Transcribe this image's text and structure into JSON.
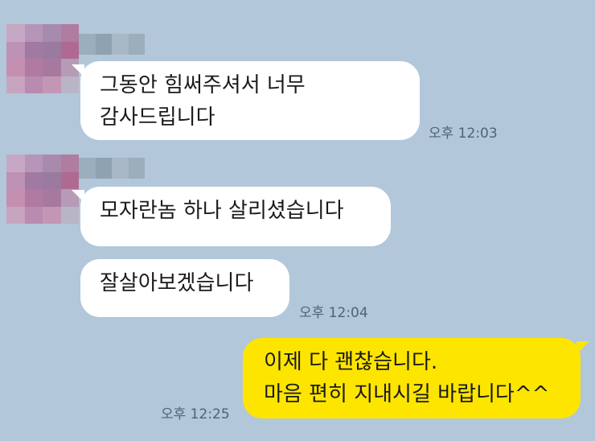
{
  "messages": [
    {
      "sender": "other",
      "text": "그동안 힘써주셔서 너무\n감사드립니다",
      "time": "오후 12:03"
    },
    {
      "sender": "other",
      "text": "모자란놈 하나 살리셨습니다",
      "time": ""
    },
    {
      "sender": "other",
      "text": "잘살아보겠습니다",
      "time": "오후 12:04"
    },
    {
      "sender": "me",
      "text": "이제 다 괜찮습니다.\n마음 편히 지내시길 바랍니다^^",
      "time": "오후 12:25"
    }
  ],
  "colors": {
    "background": "#b2c7da",
    "other_bubble": "#ffffff",
    "my_bubble": "#fee500",
    "time_text": "#4f6377"
  },
  "icons": {
    "avatar": "pixelated-profile-avatar",
    "name": "pixelated-sender-name"
  }
}
